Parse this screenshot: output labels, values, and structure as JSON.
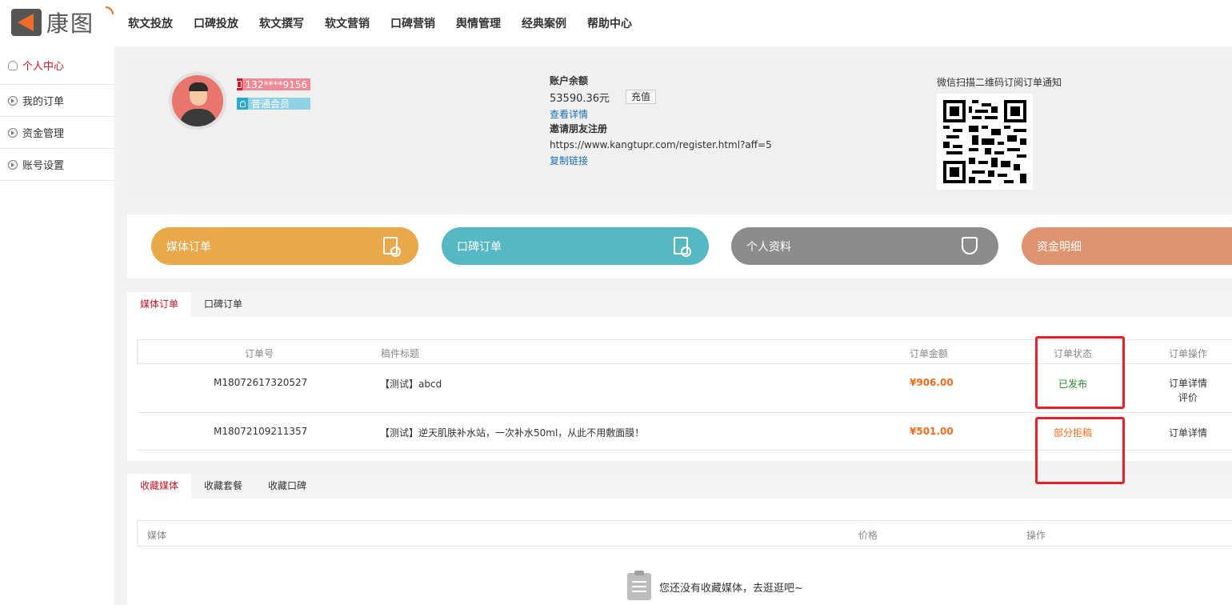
{
  "brand": {
    "name": "康图"
  },
  "nav": [
    "软文投放",
    "口碑投放",
    "软文撰写",
    "软文营销",
    "口碑营销",
    "舆情管理",
    "经典案例",
    "帮助中心"
  ],
  "sidebar": {
    "items": [
      {
        "label": "个人中心",
        "active": true
      },
      {
        "label": "我的订单"
      },
      {
        "label": "资金管理"
      },
      {
        "label": "账号设置"
      }
    ]
  },
  "profile": {
    "phone": "132****9156",
    "member_level": "普通会员",
    "balance_label": "账户余额",
    "balance": "53590.36元",
    "recharge_label": "充值",
    "details_link": "查看详情",
    "invite_label": "邀请朋友注册",
    "invite_url": "https://www.kangtupr.com/register.html?aff=5",
    "copy_link": "复制链接",
    "qr_title": "微信扫描二维码订阅订单通知"
  },
  "quick_buttons": [
    {
      "label": "媒体订单",
      "color": "#e9a94a"
    },
    {
      "label": "口碑订单",
      "color": "#55b8c3"
    },
    {
      "label": "个人资料",
      "color": "#8c8c8c"
    },
    {
      "label": "资金明细",
      "color": "#de9470"
    }
  ],
  "orders": {
    "tabs": [
      "媒体订单",
      "口碑订单"
    ],
    "columns": [
      "订单号",
      "稿件标题",
      "订单金额",
      "订单状态",
      "订单操作"
    ],
    "rows": [
      {
        "id": "M18072617320527",
        "title": "【测试】abcd",
        "amount": "¥906.00",
        "status": "已发布",
        "ops": [
          "订单详情",
          "评价"
        ]
      },
      {
        "id": "M18072109211357",
        "title": "【测试】逆天肌肤补水站，一次补水50ml，从此不用敷面膜！",
        "amount": "¥501.00",
        "status": "部分拒稿",
        "ops": [
          "订单详情"
        ]
      }
    ]
  },
  "favorites": {
    "tabs": [
      "收藏媒体",
      "收藏套餐",
      "收藏口碑"
    ],
    "columns": [
      "媒体",
      "价格",
      "操作"
    ],
    "empty_text": "您还没有收藏媒体，去逛逛吧~"
  }
}
